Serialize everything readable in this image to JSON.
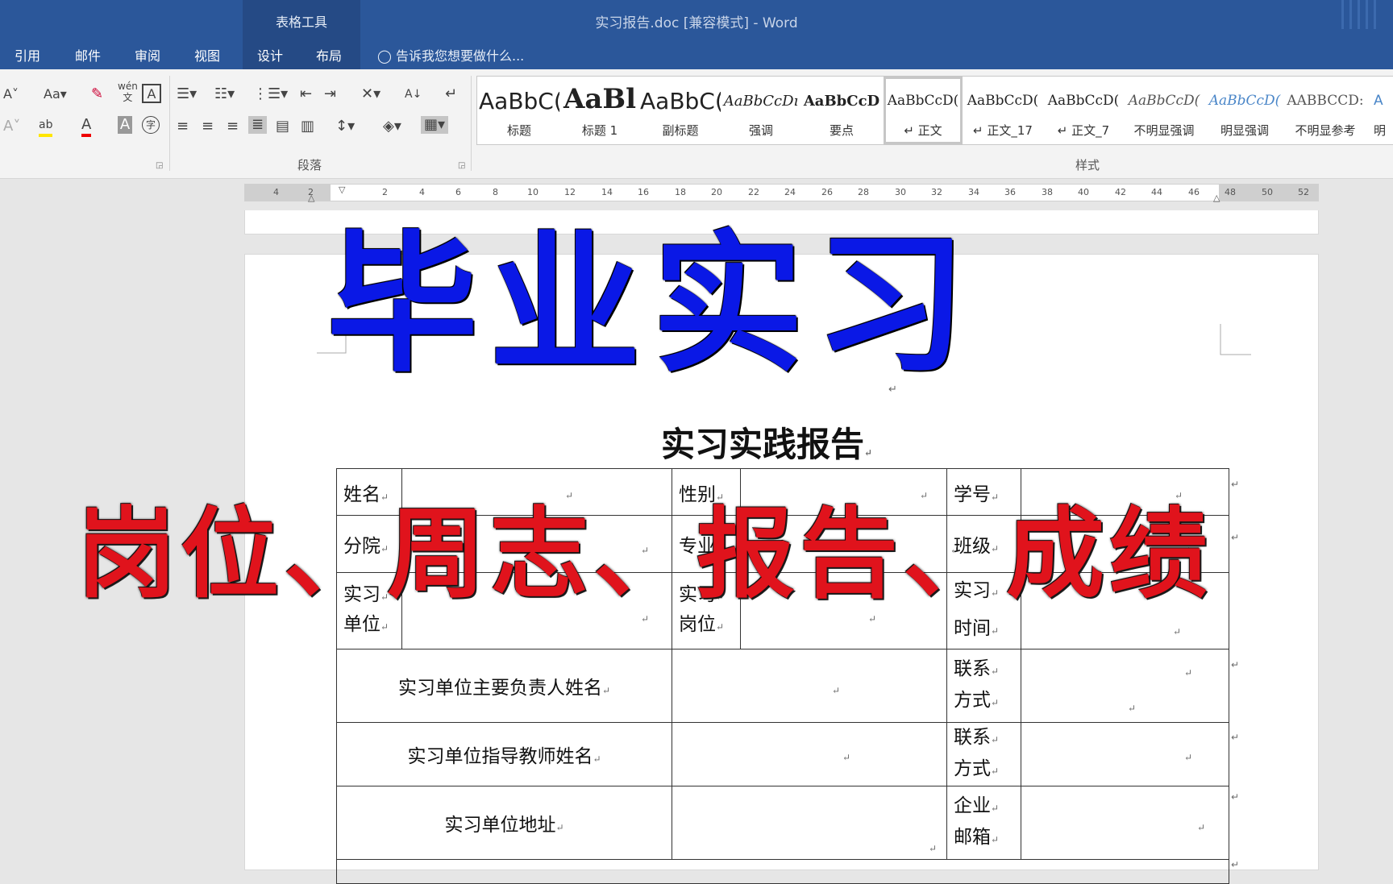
{
  "window": {
    "title": "实习报告.doc [兼容模式] - Word",
    "context_tab_group": "表格工具"
  },
  "ribbon_tabs": [
    "引用",
    "邮件",
    "审阅",
    "视图",
    "设计",
    "布局"
  ],
  "tell_me": "告诉我您想要做什么...",
  "ribbon": {
    "paragraph_group_label": "段落",
    "styles_group_label": "样式",
    "font_size_label": "Aa",
    "phonetic": "wén",
    "phonetic_char": "文",
    "char_border": "A",
    "highlight": "ab",
    "font_color": "A",
    "char_shading": "A",
    "enclose_char": "字",
    "sort": "A↓",
    "styles": [
      {
        "sample": "AaBbC(",
        "label": "标题"
      },
      {
        "sample": "AaBl",
        "label": "标题 1"
      },
      {
        "sample": "AaBbC(",
        "label": "副标题"
      },
      {
        "sample": "AaBbCcDı",
        "label": "强调"
      },
      {
        "sample": "AaBbCcD",
        "label": "要点"
      },
      {
        "sample": "AaBbCcD(",
        "label": "↵ 正文"
      },
      {
        "sample": "AaBbCcD(",
        "label": "↵ 正文_17"
      },
      {
        "sample": "AaBbCcD(",
        "label": "↵ 正文_7"
      },
      {
        "sample": "AaBbCcD(",
        "label": "不明显强调"
      },
      {
        "sample": "AaBbCcD(",
        "label": "明显强调"
      },
      {
        "sample": "AABBCCD:",
        "label": "不明显参考"
      },
      {
        "sample": "A",
        "label": "明"
      }
    ]
  },
  "ruler_numbers": [
    "4",
    "2",
    "2",
    "4",
    "6",
    "8",
    "10",
    "12",
    "14",
    "16",
    "18",
    "20",
    "22",
    "24",
    "26",
    "28",
    "30",
    "32",
    "34",
    "36",
    "38",
    "40",
    "42",
    "44",
    "46",
    "48",
    "50",
    "52"
  ],
  "document": {
    "big_title": "毕业实习",
    "report_title": "实习实践报告",
    "overlay_text": "岗位、周志、报告、成绩",
    "mark": "↵",
    "table": {
      "name": "姓名",
      "gender": "性别",
      "student_id": "学号",
      "branch": "分院",
      "major": "专业",
      "class": "班级",
      "unit_l1": "实习",
      "unit_l2": "单位",
      "post_l1": "实习",
      "post_l2": "岗位",
      "time_l1": "实习",
      "time_l2": "时间",
      "head_name": "实习单位主要负责人姓名",
      "contact_l1": "联系",
      "contact_l2": "方式",
      "teacher_name": "实习单位指导教师姓名",
      "contact2_l1": "联系",
      "contact2_l2": "方式",
      "address": "实习单位地址",
      "email_l1": "企业",
      "email_l2": "邮箱"
    }
  }
}
